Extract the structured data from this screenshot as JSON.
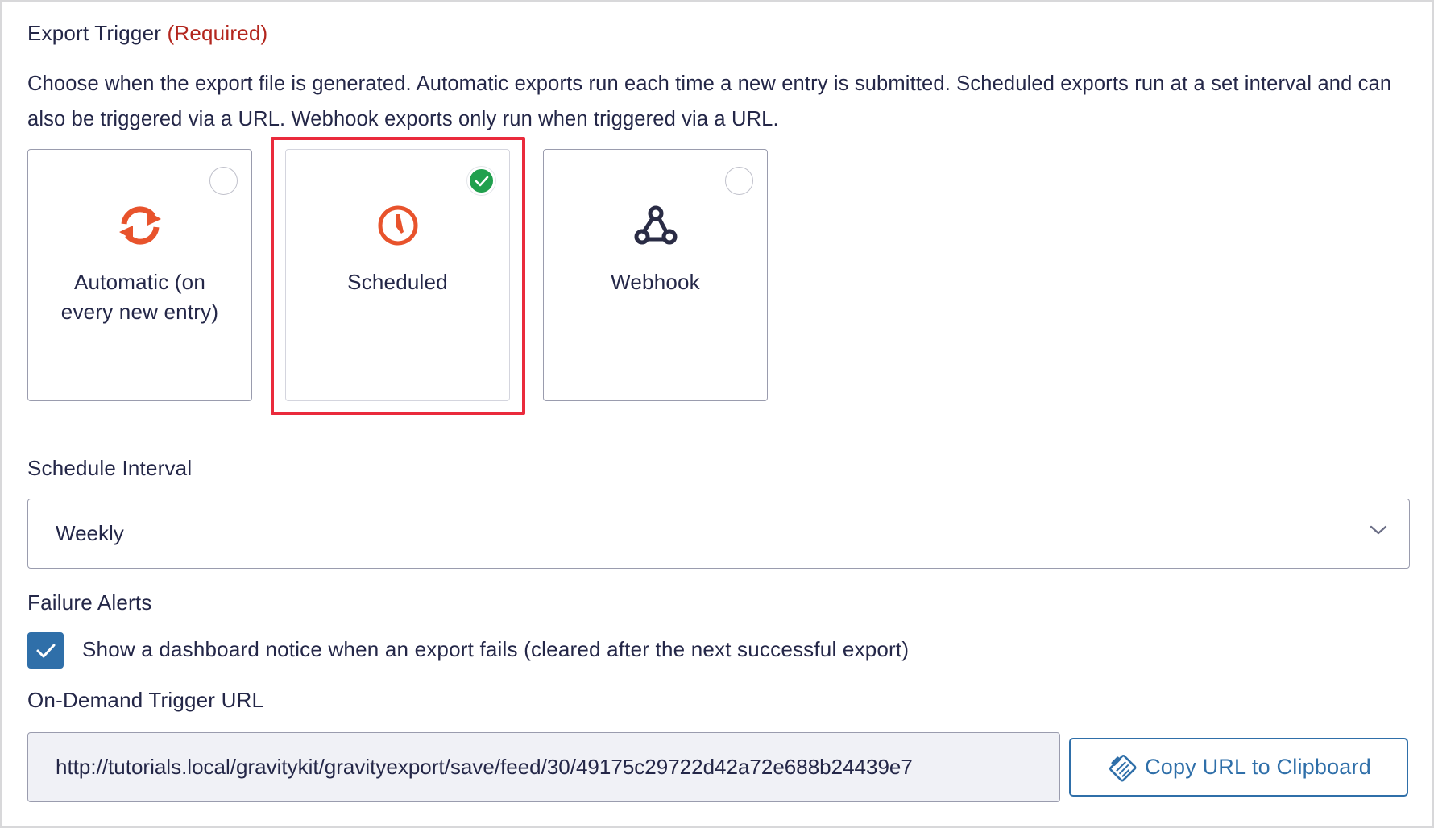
{
  "export_trigger": {
    "label": "Export Trigger",
    "required": "(Required)",
    "description": "Choose when the export file is generated. Automatic exports run each time a new entry is submitted. Scheduled exports run at a set interval and can also be triggered via a URL. Webhook exports only run when triggered via a URL.",
    "options": [
      {
        "label": "Automatic (on every new entry)",
        "icon": "sync-icon",
        "selected": false
      },
      {
        "label": "Scheduled",
        "icon": "clock-icon",
        "selected": true
      },
      {
        "label": "Webhook",
        "icon": "webhook-icon",
        "selected": false
      }
    ]
  },
  "schedule_interval": {
    "label": "Schedule Interval",
    "value": "Weekly"
  },
  "failure_alerts": {
    "label": "Failure Alerts",
    "checked": true,
    "checkbox_text": "Show a dashboard notice when an export fails (cleared after the next successful export)"
  },
  "trigger_url": {
    "label": "On-Demand Trigger URL",
    "value": "http://tutorials.local/gravitykit/gravityexport/save/feed/30/49175c29722d42a72e688b24439e7",
    "copy_button": "Copy URL to Clipboard"
  },
  "colors": {
    "accent_orange": "#e8532c",
    "selected_green": "#21a04e",
    "highlight_red": "#ea2a3c",
    "primary_blue": "#2f6fa9",
    "text_navy": "#242748"
  }
}
